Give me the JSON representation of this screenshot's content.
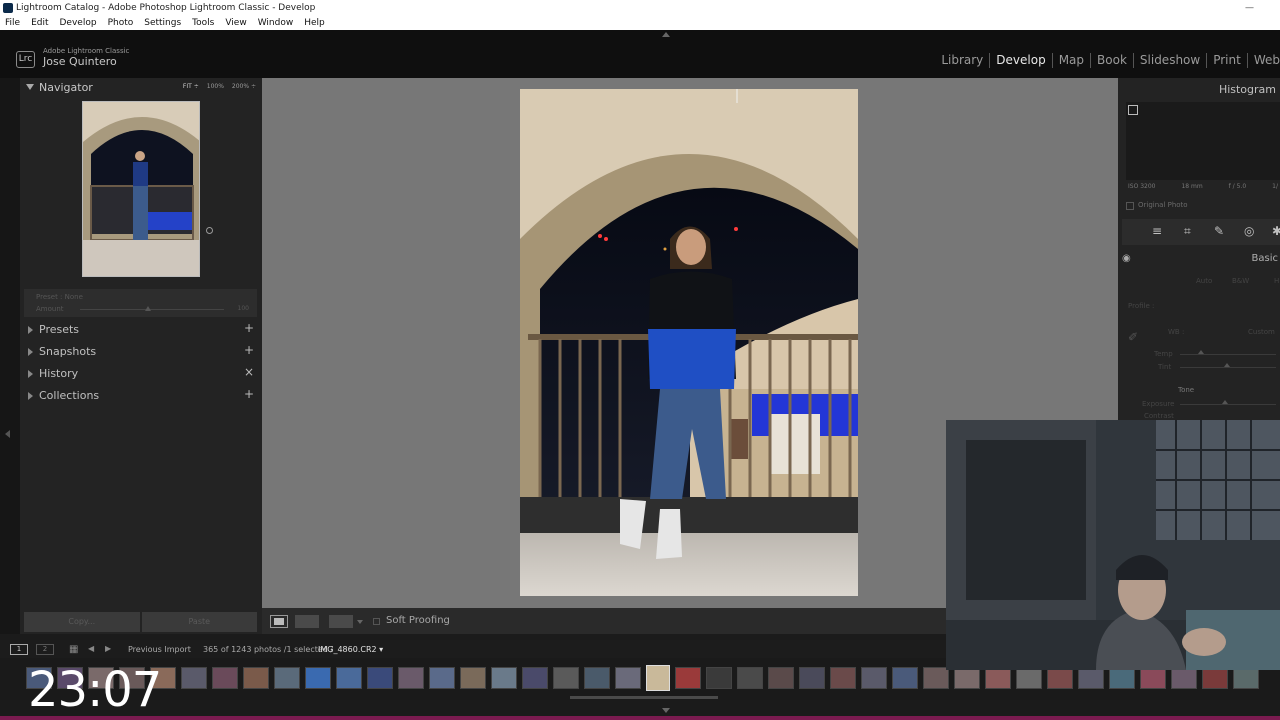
{
  "window": {
    "title": "Lightroom Catalog - Adobe Photoshop Lightroom Classic - Develop",
    "minimize_glyph": "—"
  },
  "menu": [
    "File",
    "Edit",
    "Develop",
    "Photo",
    "Settings",
    "Tools",
    "View",
    "Window",
    "Help"
  ],
  "identity": {
    "badge": "Lrc",
    "product": "Adobe Lightroom Classic",
    "user": "Jose Quintero"
  },
  "modules": {
    "items": [
      "Library",
      "Develop",
      "Map",
      "Book",
      "Slideshow",
      "Print",
      "Web"
    ],
    "active": "Develop"
  },
  "navigator": {
    "title": "Navigator",
    "zoom": [
      "FIT ÷",
      "100%",
      "200% ÷"
    ],
    "active_zoom": "FIT ÷",
    "preset_label": "Preset : None",
    "amount_label": "Amount",
    "amount_value": "100",
    "amount_level": 0.47
  },
  "left_panels": [
    {
      "label": "Presets",
      "action": "+"
    },
    {
      "label": "Snapshots",
      "action": "+"
    },
    {
      "label": "History",
      "action": "×"
    },
    {
      "label": "Collections",
      "action": "+"
    }
  ],
  "buttons": {
    "copy": "Copy...",
    "paste": "Paste"
  },
  "toolbar": {
    "soft_proofing": "Soft Proofing"
  },
  "right_panel": {
    "histogram_title": "Histogram",
    "meta": [
      "ISO 3200",
      "18 mm",
      "f / 5.0",
      "1/"
    ],
    "original_photo": "Original Photo",
    "tools": [
      "≡",
      "⌗",
      "✎",
      "◎",
      "✱"
    ],
    "basic_title": "Basic",
    "treatment": [
      "Auto",
      "B&W",
      "H"
    ],
    "profile_label": "Profile :",
    "wb_label": "WB :",
    "wb_value": "Custom",
    "temp_label": "Temp",
    "tint_label": "Tint",
    "tone_label": "Tone",
    "exposure_label": "Exposure",
    "contrast_label": "Contrast"
  },
  "filmstrip": {
    "page1": "1",
    "page2": "2",
    "grid_icon": "▦",
    "prev": "◀",
    "next": "▶",
    "source": "Previous Import",
    "count": "365 of 1243 photos /1 selected /",
    "filename": "IMG_4860.CR2 ▾",
    "thumb_colors": [
      "#4a5a7a",
      "#5a4a6a",
      "#7a6a6a",
      "#6a5a5a",
      "#8a6a5a",
      "#5a5a6a",
      "#6a4a5a",
      "#7a5a4a",
      "#5a6a7a",
      "#3a6ab0",
      "#4a6a9a",
      "#3a4a7a",
      "#6a5a6a",
      "#5a6a8a",
      "#7a6a5a",
      "#6a7a8a",
      "#4a4a6a",
      "#5a5a5a",
      "#4a5a6a",
      "#6a6a7a",
      "#c9b99a",
      "#9a3a3a",
      "#3a3a3a",
      "#4a4a4a",
      "#5a4a4a",
      "#4a4a5a",
      "#6a4a4a",
      "#5a5a6a",
      "#4a5a7a",
      "#6a5a5a",
      "#7a6a6a",
      "#8a5a5a",
      "#6a6a6a",
      "#7a4a4a",
      "#5a5a6a",
      "#4a6a7a",
      "#8a4a5a",
      "#6a5a6a",
      "#7a3a3a",
      "#5a6a6a"
    ],
    "selected_index": 20
  },
  "overlay": {
    "timer": "23:07"
  }
}
